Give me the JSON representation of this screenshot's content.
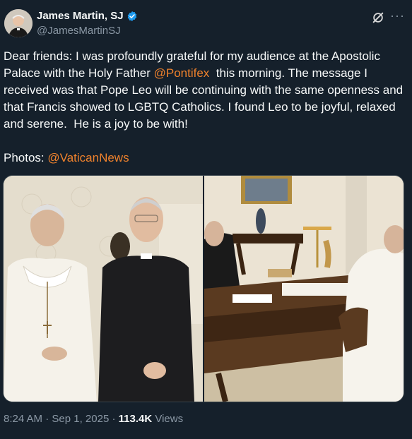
{
  "author": {
    "name": "James Martin, SJ",
    "handle": "@JamesMartinSJ"
  },
  "icons": {
    "verified": "verified-badge-icon",
    "grok": "grok-icon",
    "more": "more-options-icon"
  },
  "tweet": {
    "part1": "Dear friends: I was profoundly grateful for my audience at the Apostolic Palace with the Holy Father ",
    "mention1": "@Pontifex",
    "part2": "  this morning. The message I received was that Pope Leo will be continuing with the same openness and that Francis showed to LGBTQ Catholics. I found Leo to be joyful, relaxed and serene.  He is a joy to be with!\n\nPhotos: ",
    "mention2": "@VaticanNews"
  },
  "meta": {
    "time": "8:24 AM",
    "sep1": " · ",
    "date": "Sep 1, 2025",
    "sep2": " · ",
    "views_count": "113.4K",
    "views_label": " Views"
  },
  "colors": {
    "background": "#15202b",
    "mention": "#f0822c",
    "verified": "#1d9bf0",
    "secondary_text": "#8b98a5"
  }
}
